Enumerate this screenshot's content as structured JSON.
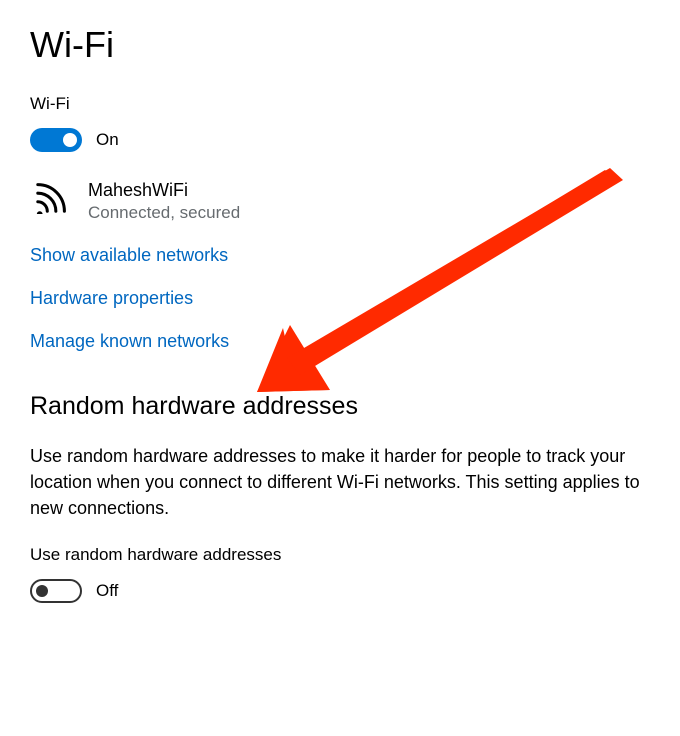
{
  "pageTitle": "Wi-Fi",
  "wifiSection": {
    "label": "Wi-Fi",
    "toggleState": "On"
  },
  "currentNetwork": {
    "name": "MaheshWiFi",
    "status": "Connected, secured"
  },
  "links": {
    "showAvailable": "Show available networks",
    "hardwareProperties": "Hardware properties",
    "manageKnown": "Manage known networks"
  },
  "randomSection": {
    "heading": "Random hardware addresses",
    "description": "Use random hardware addresses to make it harder for people to track your location when you connect to different Wi-Fi networks. This setting applies to new connections.",
    "toggleLabel": "Use random hardware addresses",
    "toggleState": "Off"
  }
}
